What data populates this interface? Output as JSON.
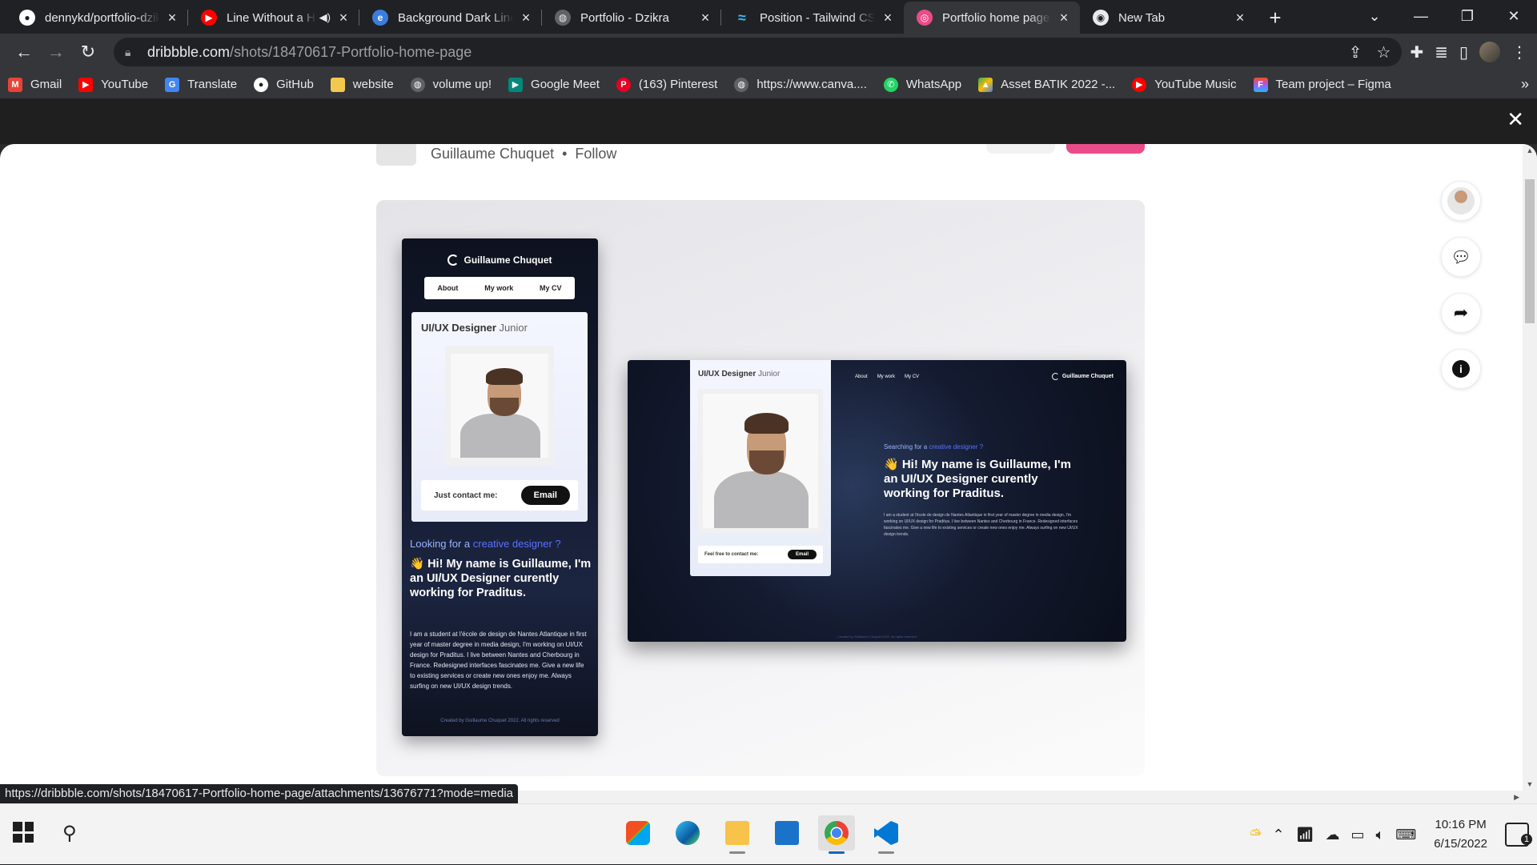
{
  "tabs": [
    {
      "title": "dennykd/portfolio-dzikra",
      "favicon": "github-icon",
      "color": "#ffffff"
    },
    {
      "title": "Line Without a Ho",
      "favicon": "youtube-icon",
      "color": "#ff0000",
      "muted": true
    },
    {
      "title": "Background Dark Lines",
      "favicon": "edge-icon",
      "color": "#3b7ddd"
    },
    {
      "title": "Portfolio - Dzikra",
      "favicon": "globe-icon",
      "color": "#9aa0a6"
    },
    {
      "title": "Position - Tailwind CSS",
      "favicon": "tailwind-icon",
      "color": "#38bdf8"
    },
    {
      "title": "Portfolio home page by Guillaume",
      "favicon": "dribbble-icon",
      "color": "#ea4c89",
      "active": true
    },
    {
      "title": "New Tab",
      "favicon": "chrome-icon",
      "color": "#e8eaed"
    }
  ],
  "address": {
    "host": "dribbble.com",
    "path": "/shots/18470617-Portfolio-home-page"
  },
  "bookmarks": [
    {
      "label": "Gmail",
      "icon": "gmail-icon",
      "color": "#ea4335"
    },
    {
      "label": "YouTube",
      "icon": "youtube-icon",
      "color": "#ff0000"
    },
    {
      "label": "Translate",
      "icon": "translate-icon",
      "color": "#4285f4"
    },
    {
      "label": "GitHub",
      "icon": "github-icon",
      "color": "#ffffff"
    },
    {
      "label": "website",
      "icon": "folder-icon",
      "color": "#f2c94c"
    },
    {
      "label": "volume up!",
      "icon": "globe-icon",
      "color": "#9aa0a6"
    },
    {
      "label": "Google Meet",
      "icon": "meet-icon",
      "color": "#00897b"
    },
    {
      "label": "(163) Pinterest",
      "icon": "pinterest-icon",
      "color": "#e60023"
    },
    {
      "label": "https://www.canva....",
      "icon": "globe-icon",
      "color": "#9aa0a6"
    },
    {
      "label": "WhatsApp",
      "icon": "whatsapp-icon",
      "color": "#25d366"
    },
    {
      "label": "Asset BATIK 2022 -...",
      "icon": "drive-icon",
      "color": "#fbbc04"
    },
    {
      "label": "YouTube Music",
      "icon": "youtube-music-icon",
      "color": "#ff0000"
    },
    {
      "label": "Team project – Figma",
      "icon": "figma-icon",
      "color": "#f24e1e"
    }
  ],
  "shot_header": {
    "author": "Guillaume Chuquet",
    "separator": "•",
    "follow": "Follow"
  },
  "phone": {
    "brand": "Guillaume Chuquet",
    "nav": [
      "About",
      "My work",
      "My CV"
    ],
    "role": "UI/UX Designer",
    "role_level": "Junior",
    "contact_label": "Just contact me:",
    "contact_button": "Email",
    "looking": "Looking for a",
    "looking_highlight": "creative designer ?",
    "headline": "👋 Hi! My name is Guillaume, I'm an UI/UX Designer curently working for Praditus.",
    "paragraph": "I am a student at l'école de design de Nantes Atlantique in first year of master degree in media design, I'm working on UI/UX design for Praditus. I live between Nantes and Cherbourg in France. Redesigned interfaces fascinates me. Give a new life to existing services or create new ones enjoy me. Always surfing on new UI/UX design trends.",
    "footer": "Created by Guillaume Chuquet 2022. All rights reserved"
  },
  "desktop": {
    "role": "UI/UX Designer",
    "role_level": "Junior",
    "nav": [
      "About",
      "My work",
      "My CV"
    ],
    "brand": "Guillaume Chuquet",
    "contact_label": "Feel free to contact me:",
    "contact_button": "Email",
    "looking": "Searching for a",
    "looking_highlight": "creative designer ?",
    "headline": "👋 Hi! My name is Guillaume, I'm an UI/UX Designer curently working for Praditus.",
    "paragraph": "I am a student at l'école de design de Nantes Atlantique in first year of master degree in media design, I'm working on UI/UX design for Praditus. I live between Nantes and Cherbourg in France. Redesigned interfaces fascinates me. Give a new life to existing services or create new ones enjoy me. Always surfing on new UI/UX design trends.",
    "footer": "Created by Guillaume Chuquet 2022. All rights reserved"
  },
  "side_actions": [
    "avatar",
    "comment-icon",
    "share-icon",
    "info-icon"
  ],
  "status_url": "https://dribbble.com/shots/18470617-Portfolio-home-page/attachments/13676771?mode=media",
  "clock": {
    "time": "10:16 PM",
    "date": "6/15/2022"
  },
  "notification_count": "1",
  "colors": {
    "accent": "#ea4c89",
    "chrome_dark": "#202124",
    "chrome_mid": "#35363a"
  }
}
